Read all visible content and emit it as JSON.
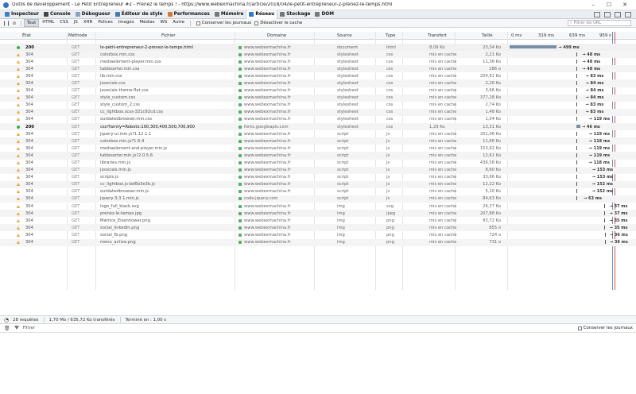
{
  "window": {
    "title": "Outils de développement - Le Petit Entrepreneur #2 - Prenez le temps ! - https://www.webexmachina.fr/article/2018/04/le-petit-entrepreneur-2-prenez-le-temps.html"
  },
  "tabs": [
    {
      "label": "Inspecteur",
      "color": "#3b82c4"
    },
    {
      "label": "Console",
      "color": "#444"
    },
    {
      "label": "Débogueur",
      "color": "#8aa2c2"
    },
    {
      "label": "Éditeur de style",
      "color": "#4a77b3"
    },
    {
      "label": "Performances",
      "color": "#d07a35"
    },
    {
      "label": "Mémoire",
      "color": "#777"
    },
    {
      "label": "Réseau",
      "color": "#2f7bc7"
    },
    {
      "label": "Stockage",
      "color": "#777"
    },
    {
      "label": "DOM",
      "color": "#777"
    }
  ],
  "filters": [
    "Tout",
    "HTML",
    "CSS",
    "JS",
    "XHR",
    "Polices",
    "Images",
    "Médias",
    "WS",
    "Autre"
  ],
  "persist_logs_label": "Conserver les journaux",
  "disable_cache_label": "Désactiver le cache",
  "url_filter_placeholder": "Filtrer les URL",
  "columns": {
    "status": "État",
    "method": "Méthode",
    "file": "Fichier",
    "domain": "Domaine",
    "cause": "Source",
    "type": "Type",
    "transfer": "Transfert",
    "size": "Taille"
  },
  "timeline_ticks": [
    "0 ms",
    "319 ms",
    "639 ms",
    "959 s"
  ],
  "requests": [
    {
      "status": "200",
      "method": "GET",
      "file": "le-petit-entrepreneur-2-prenez-le-temps.html",
      "domain": "www.webexmachina.fr",
      "cause": "document",
      "type": "html",
      "transfer": "8,09 Ko",
      "size": "23,34 Ko",
      "time": "499 ms",
      "cached": false,
      "ms_start": 0,
      "ms_end": 499
    },
    {
      "status": "304",
      "method": "GET",
      "file": "colorbox.min.css",
      "domain": "www.webexmachina.fr",
      "cause": "stylesheet",
      "type": "css",
      "transfer": "mis en cache",
      "size": "2,21 Ko",
      "time": "48 ms",
      "cached": true,
      "ms_start": 702,
      "ms_end": 750
    },
    {
      "status": "304",
      "method": "GET",
      "file": "mediaelement-player.min.css",
      "domain": "www.webexmachina.fr",
      "cause": "stylesheet",
      "type": "css",
      "transfer": "mis en cache",
      "size": "11,36 Ko",
      "time": "48 ms",
      "cached": true,
      "ms_start": 702,
      "ms_end": 750
    },
    {
      "status": "304",
      "method": "GET",
      "file": "tablesorter.min.css",
      "domain": "www.webexmachina.fr",
      "cause": "stylesheet",
      "type": "css",
      "transfer": "mis en cache",
      "size": "286 o",
      "time": "48 ms",
      "cached": true,
      "ms_start": 702,
      "ms_end": 750
    },
    {
      "status": "304",
      "method": "GET",
      "file": "lib.min.css",
      "domain": "www.webexmachina.fr",
      "cause": "stylesheet",
      "type": "css",
      "transfer": "mis en cache",
      "size": "204,91 Ko",
      "time": "83 ms",
      "cached": true,
      "ms_start": 702,
      "ms_end": 785
    },
    {
      "status": "304",
      "method": "GET",
      "file": "jssocials.css",
      "domain": "www.webexmachina.fr",
      "cause": "stylesheet",
      "type": "css",
      "transfer": "mis en cache",
      "size": "2,26 Ko",
      "time": "84 ms",
      "cached": true,
      "ms_start": 702,
      "ms_end": 786
    },
    {
      "status": "304",
      "method": "GET",
      "file": "jssocials-theme-flat.css",
      "domain": "www.webexmachina.fr",
      "cause": "stylesheet",
      "type": "css",
      "transfer": "mis en cache",
      "size": "3,66 Ko",
      "time": "84 ms",
      "cached": true,
      "ms_start": 702,
      "ms_end": 786
    },
    {
      "status": "304",
      "method": "GET",
      "file": "style_custom.css",
      "domain": "www.webexmachina.fr",
      "cause": "stylesheet",
      "type": "css",
      "transfer": "mis en cache",
      "size": "377,28 Ko",
      "time": "84 ms",
      "cached": true,
      "ms_start": 702,
      "ms_end": 786
    },
    {
      "status": "304",
      "method": "GET",
      "file": "style_custom_2.css",
      "domain": "www.webexmachina.fr",
      "cause": "stylesheet",
      "type": "css",
      "transfer": "mis en cache",
      "size": "2,74 Ko",
      "time": "83 ms",
      "cached": true,
      "ms_start": 702,
      "ms_end": 785
    },
    {
      "status": "304",
      "method": "GET",
      "file": "cc_lightbox.scss-321c92cd.css",
      "domain": "www.webexmachina.fr",
      "cause": "stylesheet",
      "type": "css",
      "transfer": "mis en cache",
      "size": "1,48 Ko",
      "time": "83 ms",
      "cached": true,
      "ms_start": 702,
      "ms_end": 785
    },
    {
      "status": "304",
      "method": "GET",
      "file": "outdatedbrowser.min.css",
      "domain": "www.webexmachina.fr",
      "cause": "stylesheet",
      "type": "css",
      "transfer": "mis en cache",
      "size": "1,04 Ko",
      "time": "119 ms",
      "cached": true,
      "ms_start": 702,
      "ms_end": 821
    },
    {
      "status": "200",
      "method": "GET",
      "file": "css?family=Roboto:100,300,400,500,700,900",
      "domain": "fonts.googleapis.com",
      "cause": "stylesheet",
      "type": "css",
      "transfer": "1,29 Ko",
      "size": "13,31 Ko",
      "time": "46 ms",
      "cached": false,
      "ms_start": 702,
      "ms_end": 748
    },
    {
      "status": "304",
      "method": "GET",
      "file": "jquery-ui.min.js?1.12.1.1",
      "domain": "www.webexmachina.fr",
      "cause": "script",
      "type": "js",
      "transfer": "mis en cache",
      "size": "251,06 Ko",
      "time": "119 ms",
      "cached": true,
      "ms_start": 702,
      "ms_end": 821
    },
    {
      "status": "304",
      "method": "GET",
      "file": "colorbox.min.js?1.6.4",
      "domain": "www.webexmachina.fr",
      "cause": "script",
      "type": "js",
      "transfer": "mis en cache",
      "size": "11,66 Ko",
      "time": "119 ms",
      "cached": true,
      "ms_start": 702,
      "ms_end": 821
    },
    {
      "status": "304",
      "method": "GET",
      "file": "mediaelement-and-player.min.js",
      "domain": "www.webexmachina.fr",
      "cause": "script",
      "type": "js",
      "transfer": "mis en cache",
      "size": "153,92 Ko",
      "time": "119 ms",
      "cached": true,
      "ms_start": 702,
      "ms_end": 821
    },
    {
      "status": "304",
      "method": "GET",
      "file": "tablesorter.min.js?2.0.5.6",
      "domain": "www.webexmachina.fr",
      "cause": "script",
      "type": "js",
      "transfer": "mis en cache",
      "size": "12,61 Ko",
      "time": "119 ms",
      "cached": true,
      "ms_start": 702,
      "ms_end": 821
    },
    {
      "status": "304",
      "method": "GET",
      "file": "libraries.min.js",
      "domain": "www.webexmachina.fr",
      "cause": "script",
      "type": "js",
      "transfer": "mis en cache",
      "size": "436,58 Ko",
      "time": "118 ms",
      "cached": true,
      "ms_start": 702,
      "ms_end": 820
    },
    {
      "status": "304",
      "method": "GET",
      "file": "jssocials.min.js",
      "domain": "www.webexmachina.fr",
      "cause": "script",
      "type": "js",
      "transfer": "mis en cache",
      "size": "8,60 Ko",
      "time": "153 ms",
      "cached": true,
      "ms_start": 702,
      "ms_end": 855
    },
    {
      "status": "304",
      "method": "GET",
      "file": "scripts.js",
      "domain": "www.webexmachina.fr",
      "cause": "script",
      "type": "js",
      "transfer": "mis en cache",
      "size": "33,66 Ko",
      "time": "153 ms",
      "cached": true,
      "ms_start": 702,
      "ms_end": 855
    },
    {
      "status": "304",
      "method": "GET",
      "file": "cc_lightbox.js-bd6b3e3b.js",
      "domain": "www.webexmachina.fr",
      "cause": "script",
      "type": "js",
      "transfer": "mis en cache",
      "size": "12,22 Ko",
      "time": "152 ms",
      "cached": true,
      "ms_start": 702,
      "ms_end": 854
    },
    {
      "status": "304",
      "method": "GET",
      "file": "outdatedbrowser.min.js",
      "domain": "www.webexmachina.fr",
      "cause": "script",
      "type": "js",
      "transfer": "mis en cache",
      "size": "5,10 Ko",
      "time": "152 ms",
      "cached": true,
      "ms_start": 702,
      "ms_end": 854
    },
    {
      "status": "304",
      "method": "GET",
      "file": "jquery-3.3.1.min.js",
      "domain": "code.jquery.com",
      "cause": "script",
      "type": "js",
      "transfer": "mis en cache",
      "size": "84,63 Ko",
      "time": "63 ms",
      "cached": true,
      "ms_start": 702,
      "ms_end": 765
    },
    {
      "status": "304",
      "method": "GET",
      "file": "logo_full_black.svg",
      "domain": "www.webexmachina.fr",
      "cause": "img",
      "type": "svg",
      "transfer": "mis en cache",
      "size": "26,37 Ko",
      "time": "37 ms",
      "cached": true,
      "ms_start": 1001,
      "ms_end": 1038
    },
    {
      "status": "304",
      "method": "GET",
      "file": "prenez-le-temps.jpg",
      "domain": "www.webexmachina.fr",
      "cause": "img",
      "type": "jpeg",
      "transfer": "mis en cache",
      "size": "207,88 Ko",
      "time": "37 ms",
      "cached": true,
      "ms_start": 1001,
      "ms_end": 1038
    },
    {
      "status": "304",
      "method": "GET",
      "file": "Matrice_Eisenhower.png",
      "domain": "www.webexmachina.fr",
      "cause": "img",
      "type": "png",
      "transfer": "mis en cache",
      "size": "83,72 Ko",
      "time": "35 ms",
      "cached": true,
      "ms_start": 1003,
      "ms_end": 1038
    },
    {
      "status": "304",
      "method": "GET",
      "file": "social_linkedin.png",
      "domain": "www.webexmachina.fr",
      "cause": "img",
      "type": "png",
      "transfer": "mis en cache",
      "size": "855 o",
      "time": "35 ms",
      "cached": true,
      "ms_start": 1003,
      "ms_end": 1038
    },
    {
      "status": "304",
      "method": "GET",
      "file": "social_fb.png",
      "domain": "www.webexmachina.fr",
      "cause": "img",
      "type": "png",
      "transfer": "mis en cache",
      "size": "724 o",
      "time": "36 ms",
      "cached": true,
      "ms_start": 1005,
      "ms_end": 1041
    },
    {
      "status": "304",
      "method": "GET",
      "file": "menu_active.png",
      "domain": "www.webexmachina.fr",
      "cause": "img",
      "type": "png",
      "transfer": "mis en cache",
      "size": "731 o",
      "time": "36 ms",
      "cached": true,
      "ms_start": 1005,
      "ms_end": 1041
    }
  ],
  "summary": {
    "requests": "28 requêtes",
    "transferred": "1,70 Mo / 635,72 Ko transférés",
    "finished": "Terminé en : 1,00 s"
  },
  "console": {
    "filter_placeholder": "Filtrer",
    "persist_label": "Conserver les journaux"
  }
}
